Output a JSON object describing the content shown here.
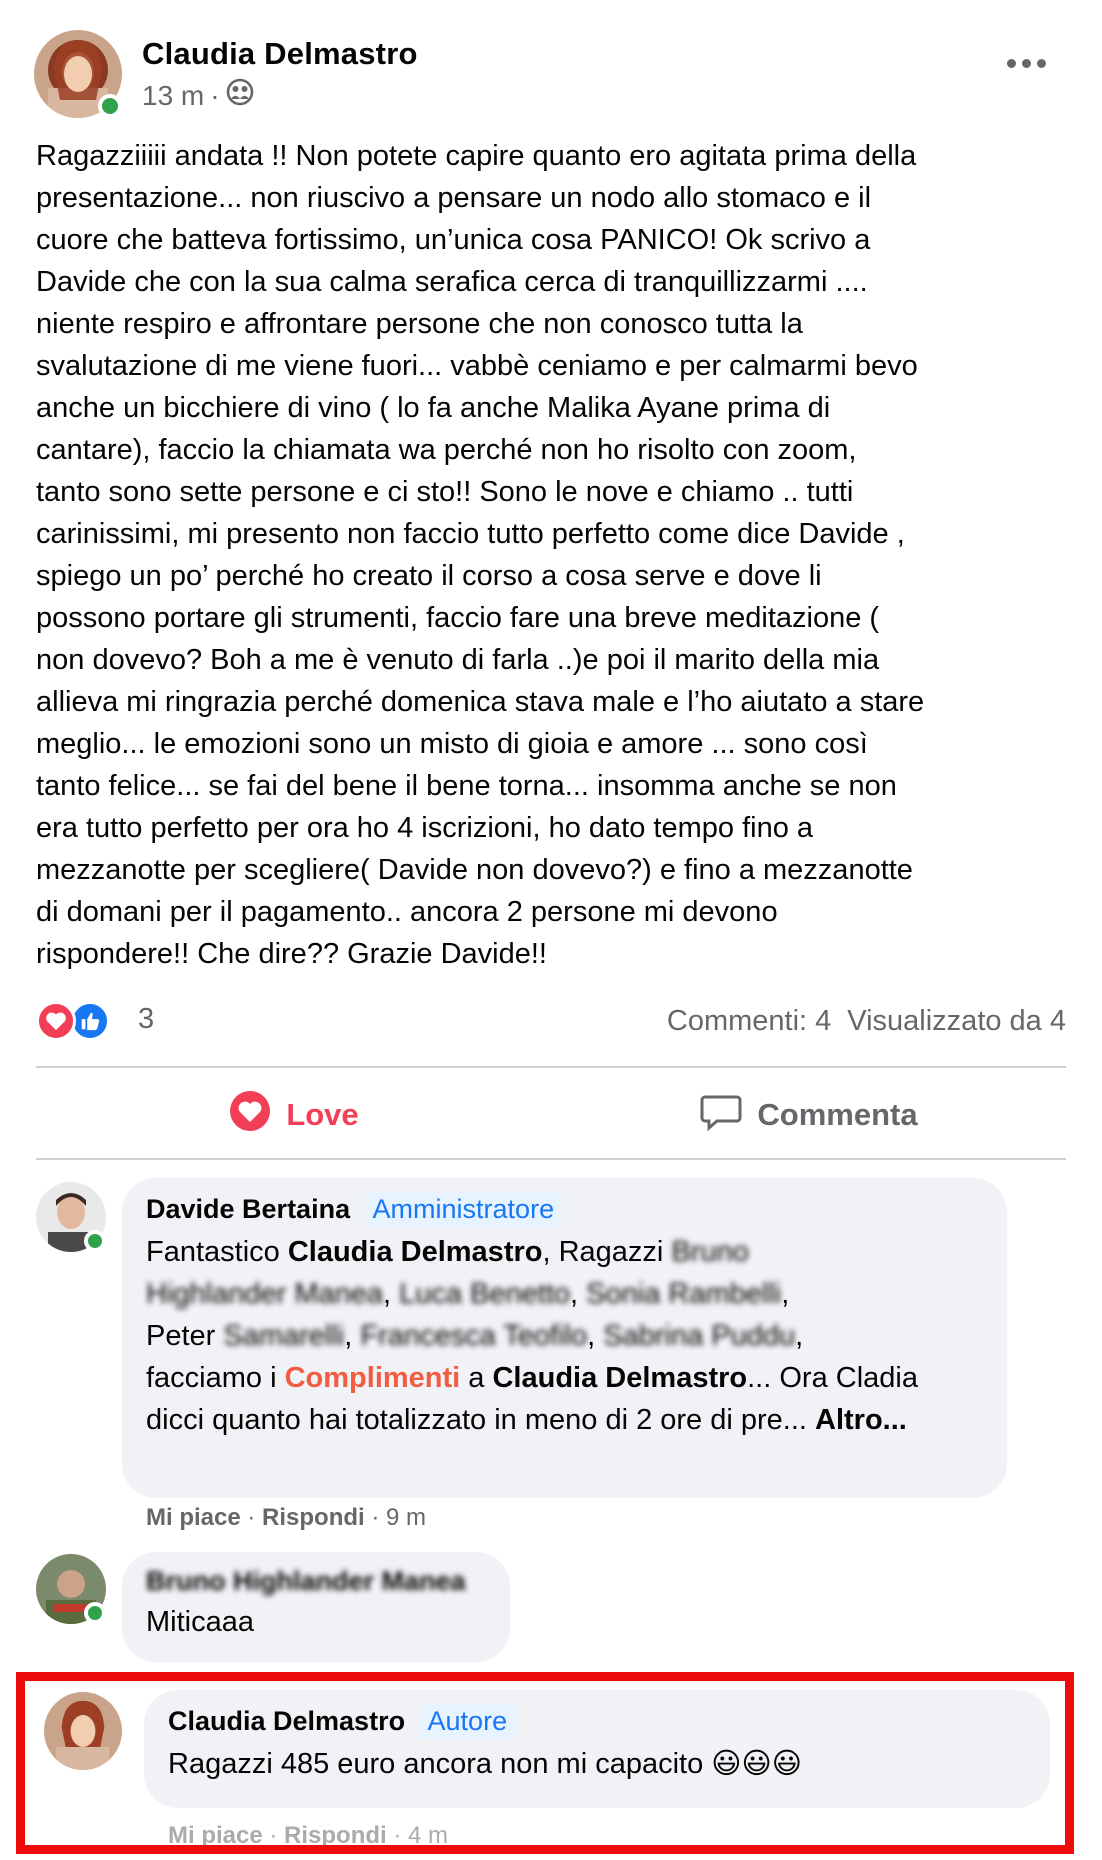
{
  "post": {
    "author": "Claudia Delmastro",
    "time": "13 m",
    "separator": "·",
    "privacy_icon": "group-icon",
    "more_icon": "more-horizontal-icon",
    "text": "Ragazziiiii andata !! Non potete capire quanto ero agitata prima della\npresentazione... non riuscivo a pensare un nodo allo stomaco e il\ncuore che batteva fortissimo, un’unica cosa PANICO! Ok scrivo a\nDavide che con la sua calma serafica cerca di tranquillizzarmi ....\nniente respiro e affrontare persone che non conosco tutta la\nsvalutazione di me viene fuori... vabbè ceniamo e per calmarmi bevo\nanche un bicchiere di vino ( lo fa anche Malika Ayane prima di\ncantare), faccio la chiamata wa perché non ho risolto con zoom,\ntanto sono sette persone e ci sto!! Sono le nove e chiamo .. tutti\ncarinissimi, mi presento non faccio tutto perfetto come dice Davide ,\nspiego un po’ perché ho creato il corso a cosa serve e dove li\npossono portare gli strumenti, faccio fare una breve meditazione (\nnon dovevo? Boh a me è venuto di farla ..)e poi il marito della mia\nallieva mi ringrazia perché domenica stava male e l’ho aiutato a stare\nmeglio... le emozioni sono un misto di gioia e amore ... sono così\ntanto felice... se fai del bene il bene torna... insomma anche se non\nera tutto perfetto per ora ho 4 iscrizioni, ho dato tempo fino a\nmezzanotte per scegliere( Davide non dovevo?) e fino a mezzanotte\ndi domani per il pagamento.. ancora 2 persone mi devono\nrispondere!! Che dire?? Grazie Davide!!"
  },
  "reactions": {
    "count": "3",
    "icons": [
      "love-reaction-icon",
      "like-reaction-icon"
    ],
    "comments": "Commenti: 4",
    "views": "Visualizzato da 4"
  },
  "actions": {
    "love_label": "Love",
    "comment_label": "Commenta",
    "love_color": "#f33e58"
  },
  "comments": [
    {
      "name": "Davide Bertaina",
      "badge": "Amministratore",
      "parts": {
        "p1": "Fantastico ",
        "n1": "Claudia Delmastro",
        "p2": ", Ragazzi ",
        "b1": "Bruno",
        "b2": "Highlander Manea",
        "b3": "Luca Benetto",
        "b4": "Sonia Rambelli",
        "b5a": "Peter ",
        "b5b": "Samarelli",
        "b6": "Francesca Teofilo",
        "b7": "Sabrina Puddu",
        "p3": "facciamo i ",
        "hl": "Complimenti",
        "p4": " a ",
        "n2": "Claudia Delmastro",
        "p5": "... Ora Cladia dicci quanto hai totalizzato in meno di 2 ore di pre... ",
        "more": "Altro..."
      },
      "like": "Mi piace",
      "reply": "Rispondi",
      "time": "9 m"
    },
    {
      "name": "Bruno Highlander Manea",
      "text": "Miticaaa"
    },
    {
      "name": "Claudia Delmastro",
      "badge": "Autore",
      "text": "Ragazzi 485 euro ancora non mi capacito 😃😃😃",
      "like": "Mi piace",
      "reply": "Rispondi",
      "time": "4 m"
    }
  ],
  "colors": {
    "highlight_box": "#ee0b0b",
    "badge_blue": "#1877f2",
    "online": "#31a24c"
  }
}
